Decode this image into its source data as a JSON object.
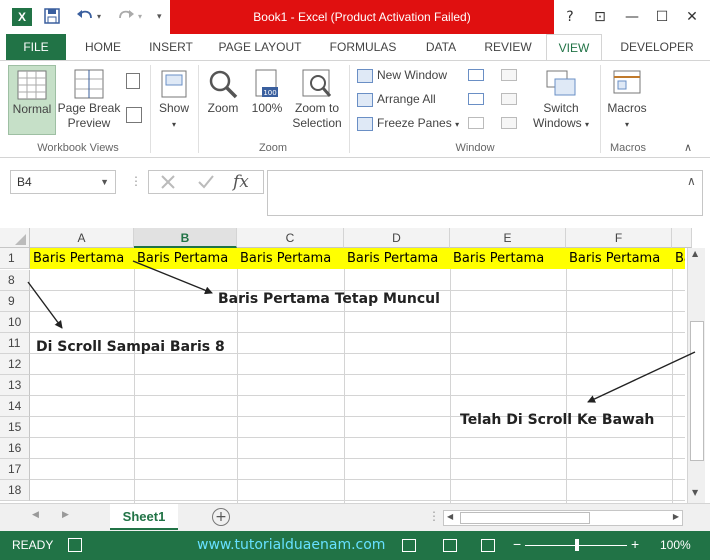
{
  "titlebar": {
    "title": "Book1 -  Excel (Product Activation Failed)",
    "help": "?",
    "restore_ribbon": "⊡",
    "minimize": "—",
    "maximize": "☐",
    "close": "✕"
  },
  "tabs": [
    {
      "label": "FILE"
    },
    {
      "label": "HOME"
    },
    {
      "label": "INSERT"
    },
    {
      "label": "PAGE LAYOUT"
    },
    {
      "label": "FORMULAS"
    },
    {
      "label": "DATA"
    },
    {
      "label": "REVIEW"
    },
    {
      "label": "VIEW"
    },
    {
      "label": "DEVELOPER"
    }
  ],
  "ribbon": {
    "normal": "Normal",
    "page_break_1": "Page Break",
    "page_break_2": "Preview",
    "show": "Show",
    "zoom": "Zoom",
    "zoom100": "100%",
    "zoom_sel_1": "Zoom to",
    "zoom_sel_2": "Selection",
    "new_window": "New Window",
    "arrange_all": "Arrange All",
    "freeze_panes": "Freeze Panes",
    "switch_1": "Switch",
    "switch_2": "Windows",
    "macros": "Macros",
    "group_workbook_views": "Workbook Views",
    "group_zoom": "Zoom",
    "group_window": "Window",
    "group_macros": "Macros"
  },
  "formula_bar": {
    "name_box": "B4",
    "formula": ""
  },
  "grid": {
    "columns": [
      "A",
      "B",
      "C",
      "D",
      "E",
      "F"
    ],
    "selected_column": "B",
    "rows": [
      "1",
      "8",
      "9",
      "10",
      "11",
      "12",
      "13",
      "14",
      "15",
      "16",
      "17",
      "18"
    ],
    "row1_values": [
      "Baris Pertama",
      "Baris Pertama",
      "Baris Pertama",
      "Baris Pertama",
      "Baris Pertama",
      "Baris Pertama",
      "Ba"
    ],
    "highlight_color": "#ffff00"
  },
  "annotations": {
    "first_row": "Baris Pertama Tetap Muncul",
    "scrolled_to": "Di Scroll Sampai Baris 8",
    "scrolled_down": "Telah Di Scroll Ke Bawah"
  },
  "sheets": [
    {
      "name": "Sheet1"
    }
  ],
  "status": {
    "ready": "READY",
    "watermark": "www.tutorialduaenam.com",
    "zoom": "100%"
  },
  "colors": {
    "excel_green": "#217346",
    "title_red": "#e01010"
  }
}
